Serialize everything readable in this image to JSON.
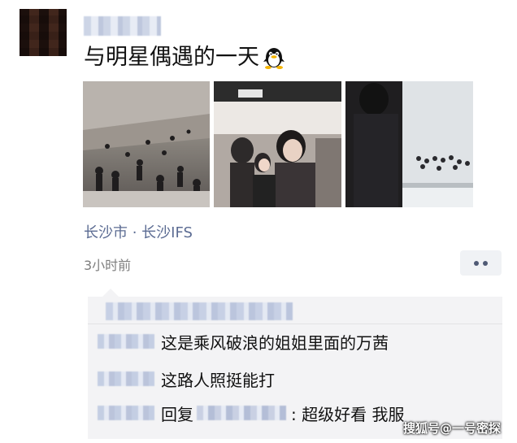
{
  "post": {
    "text": "与明星偶遇的一天",
    "emoji": "qq-penguin-icon",
    "location": "长沙市 · 长沙IFS",
    "time": "3小时前"
  },
  "photos": [
    {
      "icon": "photo-crowd-mall"
    },
    {
      "icon": "photo-celebrity-closeup"
    },
    {
      "icon": "photo-guard-crowd"
    }
  ],
  "comments": [
    {
      "text": "这是乘风破浪的姐姐里面的万茜"
    },
    {
      "text": "这路人照挺能打"
    },
    {
      "prefix": "回复",
      "text": ": 超级好看 我服"
    }
  ],
  "watermark": "搜狐号@一号密探",
  "colors": {
    "link": "#5c6c93",
    "time": "#7e7e7e",
    "comment_bg": "#f3f3f5"
  }
}
